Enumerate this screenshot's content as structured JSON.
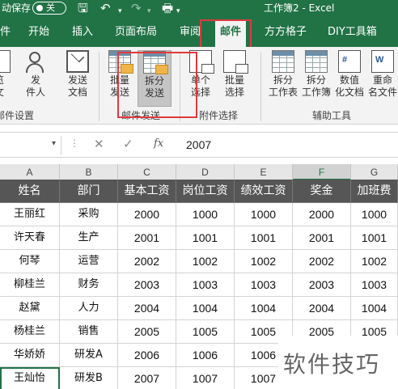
{
  "titlebar": {
    "autosave_label": "动保存",
    "autosave_state": "关",
    "title": "工作簿2  -  Excel",
    "icons": [
      "save-icon",
      "undo-icon",
      "redo-icon",
      "print-preview-icon"
    ]
  },
  "tabs": [
    "件",
    "开始",
    "插入",
    "页面布局",
    "审阅",
    "邮件",
    "方方格子",
    "DIY工具箱"
  ],
  "active_tab": "邮件",
  "ribbon": {
    "partial_labels": {
      "a": "览",
      "b": "文",
      "c": "件"
    },
    "group_left_label": "邮件设置",
    "send_doc": {
      "line1": "发送",
      "line2": "文档"
    },
    "recipient": {
      "line1": "发",
      "line2": "件人"
    },
    "batch_send": {
      "line1": "批量",
      "line2": "发送"
    },
    "split_send": {
      "line1": "拆分",
      "line2": "发送"
    },
    "single_select": {
      "line1": "单个",
      "line2": "选择"
    },
    "batch_select": {
      "line1": "批量",
      "line2": "选择"
    },
    "split_sheet": {
      "line1": "拆分",
      "line2": "工作表"
    },
    "split_book": {
      "line1": "拆分",
      "line2": "工作簿"
    },
    "num_doc": {
      "line1": "数值",
      "line2": "化文档"
    },
    "rename": {
      "line1": "重命",
      "line2": "名文件"
    },
    "group_mail_send": "邮件发送",
    "group_attachment": "附件选择",
    "group_aux": "辅助工具"
  },
  "formula_bar": {
    "fx_label": "fx",
    "value": "2007"
  },
  "columns": [
    "A",
    "B",
    "C",
    "D",
    "E",
    "F",
    "G"
  ],
  "selected_column": "F",
  "table": {
    "headers": [
      "姓名",
      "部门",
      "基本工资",
      "岗位工资",
      "绩效工资",
      "奖金",
      "加班费"
    ],
    "rows": [
      [
        "王丽红",
        "采购",
        "2000",
        "1000",
        "1000",
        "2000",
        "1000"
      ],
      [
        "许天春",
        "生产",
        "2001",
        "1001",
        "1001",
        "2001",
        "1001"
      ],
      [
        "何琴",
        "运营",
        "2002",
        "1002",
        "1002",
        "2002",
        "1002"
      ],
      [
        "柳桂兰",
        "财务",
        "2003",
        "1003",
        "1003",
        "2003",
        "1003"
      ],
      [
        "赵黛",
        "人力",
        "2004",
        "1004",
        "1004",
        "2004",
        "1004"
      ],
      [
        "杨桂兰",
        "销售",
        "2005",
        "1005",
        "1005",
        "2005",
        "1005"
      ],
      [
        "华娇娇",
        "研发A",
        "2006",
        "1006",
        "1006"
      ],
      [
        "王灿怡",
        "研发B",
        "2007",
        "1007",
        "1007"
      ]
    ]
  },
  "watermark": "软件技巧",
  "colors": {
    "excel_green": "#217346",
    "header_fill": "#565656",
    "highlight_red": "#e0393e"
  }
}
